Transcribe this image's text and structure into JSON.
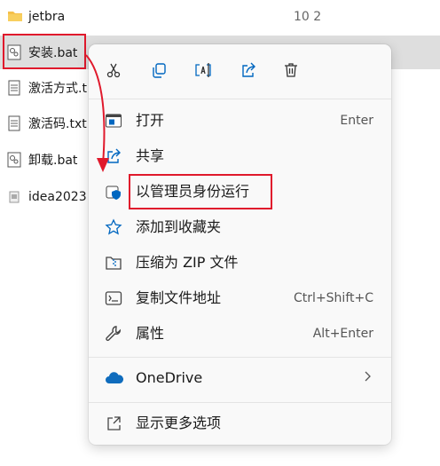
{
  "files": [
    {
      "name": "jetbra",
      "date": "10 2",
      "icon": "folder-icon"
    },
    {
      "name": "安装.bat",
      "date": "",
      "icon": "batch-file-icon"
    },
    {
      "name": "激活方式.t",
      "date": "",
      "icon": "text-file-icon"
    },
    {
      "name": "激活码.txt",
      "date": "",
      "icon": "text-file-icon"
    },
    {
      "name": "卸载.bat",
      "date": "",
      "icon": "batch-file-icon"
    },
    {
      "name": "idea2023",
      "date": "",
      "icon": "image-file-icon"
    }
  ],
  "toolbar": [
    {
      "name": "cut",
      "icon": "scissors-icon"
    },
    {
      "name": "copy",
      "icon": "copy-icon"
    },
    {
      "name": "rename",
      "icon": "rename-icon"
    },
    {
      "name": "share",
      "icon": "share-icon"
    },
    {
      "name": "delete",
      "icon": "trash-icon"
    }
  ],
  "menu": {
    "open": {
      "label": "打开",
      "shortcut": "Enter"
    },
    "share": {
      "label": "共享"
    },
    "run_as_admin": {
      "label": "以管理员身份运行"
    },
    "add_favorites": {
      "label": "添加到收藏夹"
    },
    "compress_zip": {
      "label": "压缩为 ZIP 文件"
    },
    "copy_path": {
      "label": "复制文件地址",
      "shortcut": "Ctrl+Shift+C"
    },
    "properties": {
      "label": "属性",
      "shortcut": "Alt+Enter"
    },
    "onedrive": {
      "label": "OneDrive"
    },
    "more_options": {
      "label": "显示更多选项"
    }
  },
  "colors": {
    "annotation": "#e0192c",
    "accent": "#0067c0",
    "selection": "#dedede"
  }
}
